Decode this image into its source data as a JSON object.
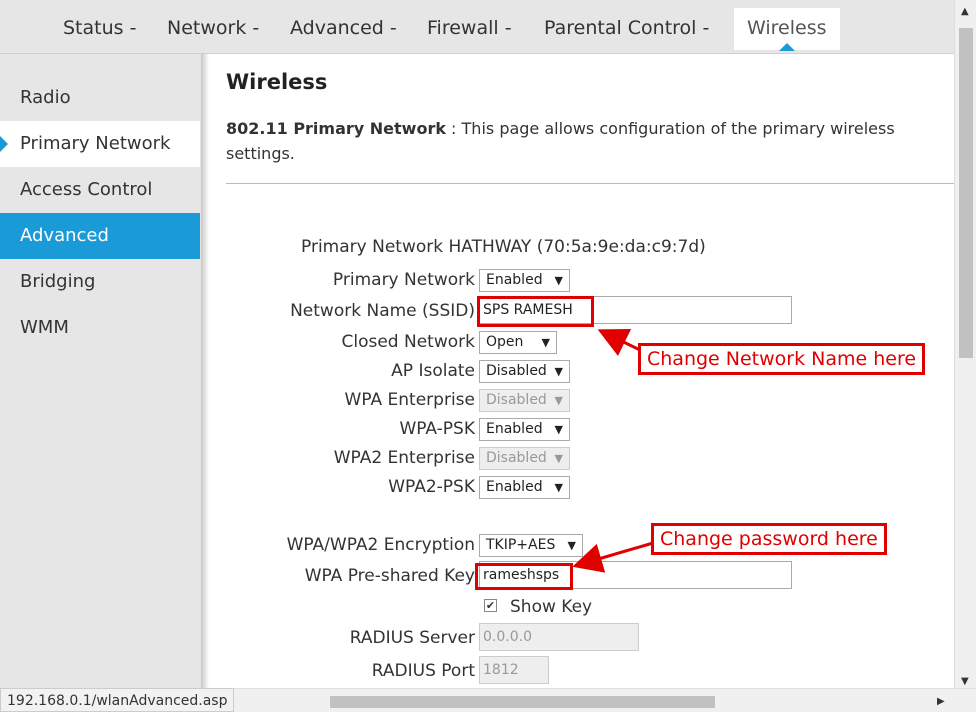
{
  "top_nav": {
    "tabs": [
      "Status -",
      "Network -",
      "Advanced -",
      "Firewall -",
      "Parental Control -",
      "Wireless"
    ],
    "active": "Wireless",
    "accent_color": "#1a9ad6"
  },
  "sidebar": {
    "items": [
      "Radio",
      "Primary Network",
      "Access Control",
      "Advanced",
      "Bridging",
      "WMM"
    ],
    "selected": "Primary Network",
    "highlighted": "Advanced"
  },
  "main": {
    "title": "Wireless",
    "description_bold": "802.11 Primary Network",
    "description_text": " :  This page allows configuration of the primary wireless settings.",
    "network_heading": "Primary Network HATHWAY (70:5a:9e:da:c9:7d)"
  },
  "form": {
    "primary_network": {
      "label": "Primary Network",
      "value": "Enabled"
    },
    "ssid": {
      "label": "Network Name (SSID)",
      "value": "SPS RAMESH"
    },
    "closed_network": {
      "label": "Closed Network",
      "value": "Open"
    },
    "ap_isolate": {
      "label": "AP Isolate",
      "value": "Disabled"
    },
    "wpa_enterprise": {
      "label": "WPA Enterprise",
      "value": "Disabled"
    },
    "wpa_psk": {
      "label": "WPA-PSK",
      "value": "Enabled"
    },
    "wpa2_enterprise": {
      "label": "WPA2 Enterprise",
      "value": "Disabled"
    },
    "wpa2_psk": {
      "label": "WPA2-PSK",
      "value": "Enabled"
    },
    "encryption": {
      "label": "WPA/WPA2 Encryption",
      "value": "TKIP+AES"
    },
    "psk": {
      "label": "WPA Pre-shared Key",
      "value": "rameshsps"
    },
    "show_key": {
      "label": "Show Key",
      "checked": true
    },
    "radius_server": {
      "label": "RADIUS Server",
      "value": "0.0.0.0"
    },
    "radius_port": {
      "label": "RADIUS Port",
      "value": "1812"
    }
  },
  "annotations": {
    "network_name_note": "Change Network Name here",
    "password_note": "Change password here",
    "color": "#e00000"
  },
  "status_bar": {
    "url": "192.168.0.1/wlanAdvanced.asp"
  }
}
